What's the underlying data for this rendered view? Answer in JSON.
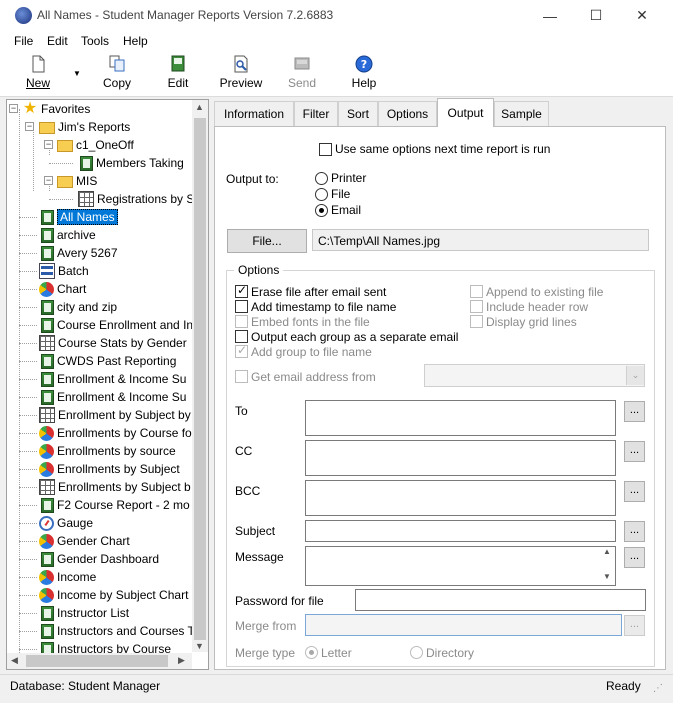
{
  "window": {
    "title": "All Names - Student Manager Reports Version 7.2.6883",
    "minimize_glyph": "—",
    "maximize_glyph": "☐",
    "close_glyph": "✕"
  },
  "menu": [
    "File",
    "Edit",
    "Tools",
    "Help"
  ],
  "toolbar": {
    "new": "New",
    "copy": "Copy",
    "edit": "Edit",
    "preview": "Preview",
    "send": "Send",
    "help": "Help",
    "dropdown_glyph": "▼"
  },
  "tree": {
    "favorites": "Favorites",
    "jims_reports": "Jim's Reports",
    "c1_oneoff": "c1_OneOff",
    "members_taking": "Members Taking",
    "mis": "MIS",
    "registrations": "Registrations by S",
    "items": [
      {
        "label": "All Names",
        "icon": "report-icon"
      },
      {
        "label": "archive",
        "icon": "report-icon"
      },
      {
        "label": "Avery 5267",
        "icon": "report-icon"
      },
      {
        "label": "Batch",
        "icon": "batch-icon"
      },
      {
        "label": "Chart",
        "icon": "pie-chart-icon"
      },
      {
        "label": "city and zip",
        "icon": "report-icon"
      },
      {
        "label": "Course Enrollment and In",
        "icon": "report-icon"
      },
      {
        "label": "Course Stats by Gender",
        "icon": "crosstab-icon"
      },
      {
        "label": "CWDS Past Reporting",
        "icon": "report-icon"
      },
      {
        "label": "Enrollment & Income Su",
        "icon": "report-icon"
      },
      {
        "label": "Enrollment & Income Su",
        "icon": "report-icon"
      },
      {
        "label": "Enrollment by Subject by",
        "icon": "crosstab-icon"
      },
      {
        "label": "Enrollments by Course fo",
        "icon": "pie-chart-icon"
      },
      {
        "label": "Enrollments by source",
        "icon": "pie-chart-icon"
      },
      {
        "label": "Enrollments by Subject",
        "icon": "pie-chart-icon"
      },
      {
        "label": "Enrollments by Subject b",
        "icon": "crosstab-icon"
      },
      {
        "label": "F2 Course Report - 2 mo",
        "icon": "report-icon"
      },
      {
        "label": "Gauge",
        "icon": "gauge-icon"
      },
      {
        "label": "Gender Chart",
        "icon": "pie-chart-icon"
      },
      {
        "label": "Gender Dashboard",
        "icon": "report-icon"
      },
      {
        "label": "Income",
        "icon": "pie-chart-icon"
      },
      {
        "label": "Income by Subject Chart",
        "icon": "pie-chart-icon"
      },
      {
        "label": "Instructor List",
        "icon": "report-icon"
      },
      {
        "label": "Instructors and Courses T",
        "icon": "report-icon"
      },
      {
        "label": "Instructors by Course",
        "icon": "report-icon"
      }
    ]
  },
  "tabs": [
    "Information",
    "Filter",
    "Sort",
    "Options",
    "Output",
    "Sample"
  ],
  "output": {
    "same_options": "Use same options next time report is run",
    "output_to": "Output to:",
    "printer": "Printer",
    "file": "File",
    "email": "Email",
    "file_button": "File...",
    "file_path": "C:\\Temp\\All Names.jpg",
    "options_title": "Options",
    "erase_file": "Erase file after email sent",
    "add_timestamp": "Add timestamp to file name",
    "embed_fonts": "Embed fonts in the file",
    "output_each_group": "Output each group as a separate email",
    "add_group": "Add group to file name",
    "append_existing": "Append to existing file",
    "include_header": "Include header row",
    "display_grid": "Display grid lines",
    "get_email": "Get email address from",
    "to": "To",
    "cc": "CC",
    "bcc": "BCC",
    "subject": "Subject",
    "message": "Message",
    "password": "Password for file",
    "merge_from": "Merge from",
    "merge_type": "Merge type",
    "letter": "Letter",
    "directory": "Directory",
    "ellipsis": "..."
  },
  "status": {
    "database": "Database: Student Manager",
    "state": "Ready"
  }
}
